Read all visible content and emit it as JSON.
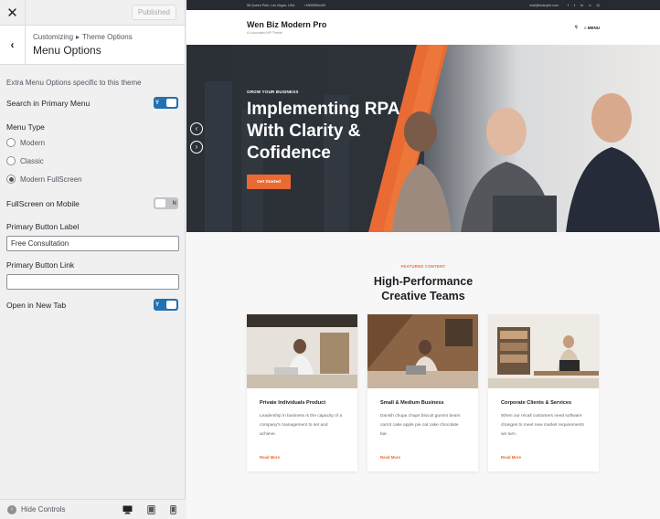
{
  "customizer": {
    "close_glyph": "✕",
    "published_label": "Published",
    "back_glyph": "‹",
    "breadcrumb_root": "Customizing",
    "breadcrumb_sep": "▸",
    "breadcrumb_parent": "Theme Options",
    "section_title": "Menu Options",
    "description": "Extra Menu Options specific to this theme",
    "search_toggle": {
      "label": "Search in Primary Menu",
      "state": "Y"
    },
    "menu_type": {
      "label": "Menu Type",
      "options": [
        "Modern",
        "Classic",
        "Modern FullScreen"
      ],
      "selected": "Modern FullScreen"
    },
    "fullscreen_mobile": {
      "label": "FullScreen on Mobile",
      "state": "N"
    },
    "primary_button_label": {
      "label": "Primary Button Label",
      "value": "Free Consultation"
    },
    "primary_button_link": {
      "label": "Primary Button Link",
      "value": ""
    },
    "new_tab": {
      "label": "Open in New Tab",
      "state": "Y"
    },
    "footer": {
      "hide_label": "Hide Controls",
      "hide_glyph": "‹"
    }
  },
  "preview": {
    "topbar": {
      "address": "56 Queen Park, Los Vegas, USA",
      "phone": "+1800555xx00",
      "email": "mail@example.com",
      "social": [
        "f",
        "t",
        "in",
        "o",
        "◎"
      ]
    },
    "brand": {
      "name": "Wen Biz Modern Pro",
      "tagline": "A Loooooked WP Theme"
    },
    "nav": {
      "search_glyph": "⚲",
      "menu_label": "≡ MENU"
    },
    "hero": {
      "kicker": "GROW YOUR BUSINESS",
      "title": "Implementing RPA With Clarity & Cofidence",
      "button": "Get Started",
      "prev_glyph": "‹",
      "next_glyph": "›"
    },
    "featured": {
      "kicker": "FEATURED CONTENT",
      "title": "High-Performance Creative Teams",
      "cards": [
        {
          "title": "Private Individuals Product",
          "text": "Leadership in business is the capacity of a company's management to set and achieve.",
          "more": "Read More"
        },
        {
          "title": "Small & Medium Business",
          "text": "Danish chupa chups biscuit gummi bears carrot cake apple pie cat cake chocolate bar.",
          "more": "Read More"
        },
        {
          "title": "Corporate Clients & Services",
          "text": "When our recall customers need software changes to meet new market requirements we turn.",
          "more": "Read More"
        }
      ]
    }
  },
  "colors": {
    "accent": "#2271b1",
    "orange": "#e96a33",
    "dark": "#262a33"
  }
}
